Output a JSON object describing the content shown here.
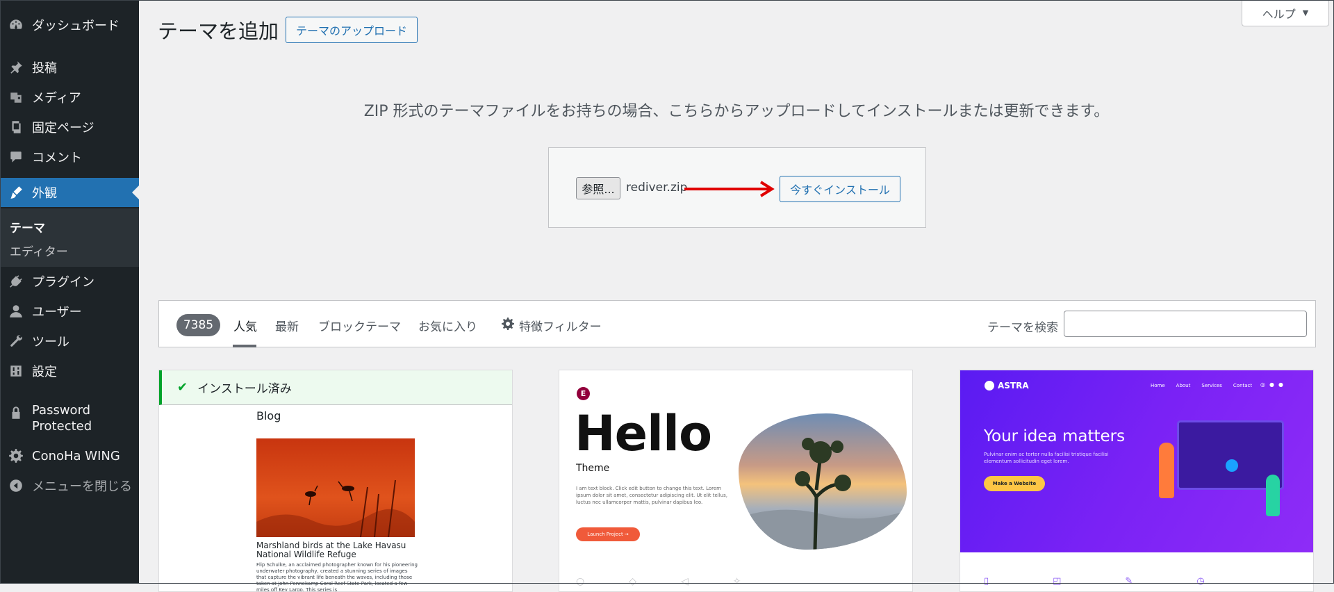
{
  "sidebar": {
    "items": [
      {
        "label": "ダッシュボード",
        "icon": "dashboard-icon"
      },
      {
        "label": "投稿",
        "icon": "pushpin-icon"
      },
      {
        "label": "メディア",
        "icon": "media-icon"
      },
      {
        "label": "固定ページ",
        "icon": "pages-icon"
      },
      {
        "label": "コメント",
        "icon": "comment-icon"
      },
      {
        "label": "外観",
        "icon": "brush-icon"
      },
      {
        "label": "プラグイン",
        "icon": "plugin-icon"
      },
      {
        "label": "ユーザー",
        "icon": "user-icon"
      },
      {
        "label": "ツール",
        "icon": "wrench-icon"
      },
      {
        "label": "設定",
        "icon": "settings-icon"
      },
      {
        "label": "Password Protected",
        "icon": "lock-icon"
      },
      {
        "label": "ConoHa WING",
        "icon": "gear-icon"
      },
      {
        "label": "メニューを閉じる",
        "icon": "collapse-icon"
      }
    ],
    "submenu": [
      {
        "label": "テーマ"
      },
      {
        "label": "エディター"
      }
    ]
  },
  "header": {
    "title": "テーマを追加",
    "upload_button": "テーマのアップロード",
    "help_label": "ヘルプ",
    "help_arrow": "▼"
  },
  "upload": {
    "description": "ZIP 形式のテーマファイルをお持ちの場合、こちらからアップロードしてインストールまたは更新できます。",
    "browse_label": "参照...",
    "file_name": "rediver.zip",
    "install_label": "今すぐインストール"
  },
  "filter": {
    "count": "7385",
    "tabs": [
      "人気",
      "最新",
      "ブロックテーマ",
      "お気に入り"
    ],
    "feature_filter": "特徴フィルター",
    "search_label": "テーマを検索"
  },
  "themes": {
    "card1": {
      "installed": "インストール済み",
      "check": "✔",
      "blog": "Blog",
      "caption": "Marshland birds at the Lake Havasu National Wildlife Refuge",
      "body": "Flip Schulke, an acclaimed photographer known for his pioneering underwater photography, created a stunning series of images that capture the vibrant life beneath the waves, including those taken at John Pennekamp Coral Reef State Park, located a few miles off Key Largo. This series is"
    },
    "card2": {
      "logo": "E",
      "title": "Hello",
      "subtitle": "Theme",
      "body": "I am text block. Click edit button to change this text. Lorem ipsum dolor sit amet, consectetur adipiscing elit. Ut elit tellus, luctus nec ullamcorper mattis, pulvinar dapibus leo.",
      "button": "Launch Project →"
    },
    "card3": {
      "brand": "ASTRA",
      "nav": [
        "Home",
        "About",
        "Services",
        "Contact"
      ],
      "title": "Your idea matters",
      "body": "Pulvinar enim ac tortor nulla facilisi tristique facilisi elementum sollicitudin eget lorem.",
      "button": "Make a Website"
    }
  },
  "colors": {
    "sidebar_bg": "#1d2327",
    "accent": "#2271b1",
    "installed_green": "#00a32a",
    "arrow_red": "#e00000"
  }
}
